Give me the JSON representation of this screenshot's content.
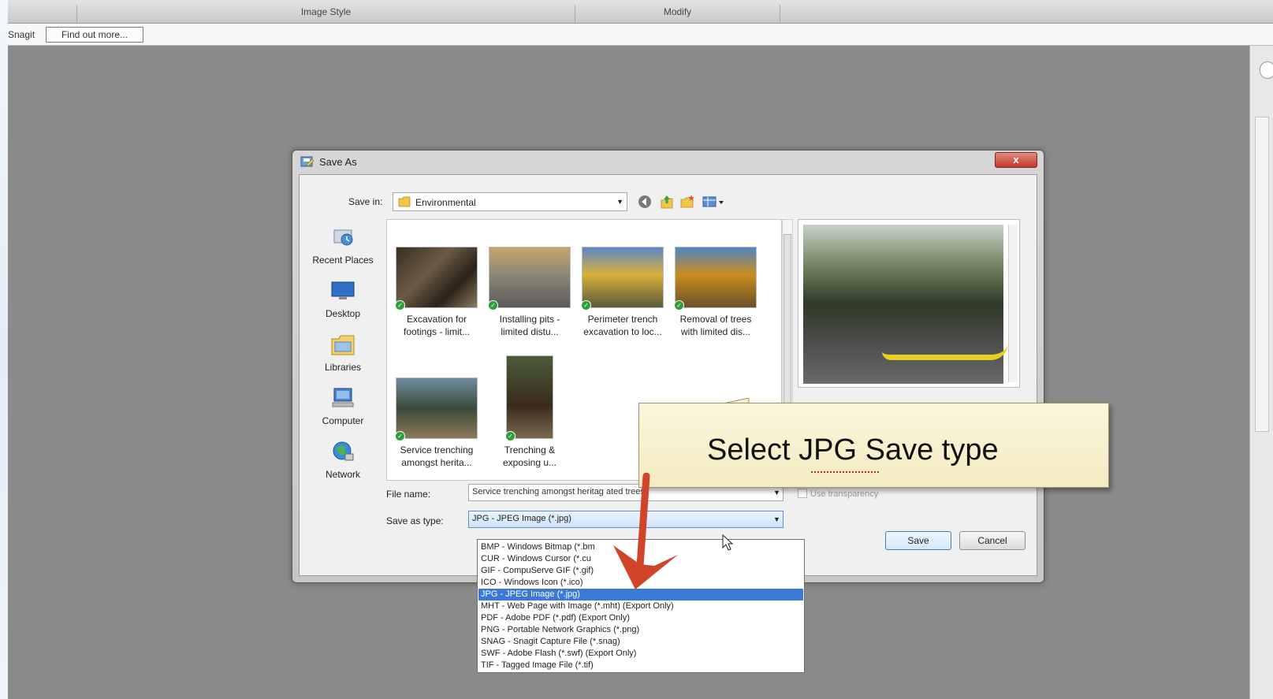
{
  "ribbon": {
    "groups": [
      "",
      "Image Style",
      "Modify"
    ]
  },
  "snagit_bar": {
    "label": "Snagit",
    "find_out_button": "Find out more..."
  },
  "dialog": {
    "title": "Save As",
    "close_glyph": "x",
    "save_in_label": "Save in:",
    "save_in_value": "Environmental",
    "places": [
      {
        "label": "Recent Places",
        "icon": "recent-places-icon"
      },
      {
        "label": "Desktop",
        "icon": "desktop-icon"
      },
      {
        "label": "Libraries",
        "icon": "libraries-icon"
      },
      {
        "label": "Computer",
        "icon": "computer-icon"
      },
      {
        "label": "Network",
        "icon": "network-icon"
      }
    ],
    "files": [
      {
        "line1": "Excavation for",
        "line2": "footings - limit..."
      },
      {
        "line1": "Installing pits -",
        "line2": "limited distu..."
      },
      {
        "line1": "Perimeter trench",
        "line2": "excavation to loc..."
      },
      {
        "line1": "Removal of trees",
        "line2": "with limited dis..."
      },
      {
        "line1": "Service trenching",
        "line2": "amongst herita..."
      },
      {
        "line1": "Trenching &",
        "line2": "exposing u..."
      }
    ],
    "file_name_label": "File name:",
    "file_name_value": "Service trenching amongst heritag    ated trees.",
    "save_as_type_label": "Save as type:",
    "save_as_type_value": "JPG - JPEG Image (*.jpg)",
    "use_transparency": "Use transparency",
    "save_button": "Save",
    "cancel_button": "Cancel"
  },
  "type_options": [
    "BMP - Windows Bitmap (*.bm",
    "CUR - Windows Cursor (*.cu",
    "GIF - CompuServe GIF (*.gif)",
    "ICO - Windows Icon (*.ico)",
    "JPG - JPEG Image (*.jpg)",
    "MHT - Web Page with Image (*.mht) (Export Only)",
    "PDF - Adobe PDF (*.pdf) (Export Only)",
    "PNG - Portable Network Graphics (*.png)",
    "SNAG - Snagit Capture File (*.snag)",
    "SWF - Adobe Flash (*.swf) (Export Only)",
    "TIF - Tagged Image File (*.tif)"
  ],
  "selected_type_index": 4,
  "callout": {
    "text": "Select JPG Save type"
  },
  "colors": {
    "canvas": "#8a8a8a",
    "selection": "#3a79d6",
    "arrow": "#d0452a",
    "callout_bg": "#f8f1d0"
  }
}
